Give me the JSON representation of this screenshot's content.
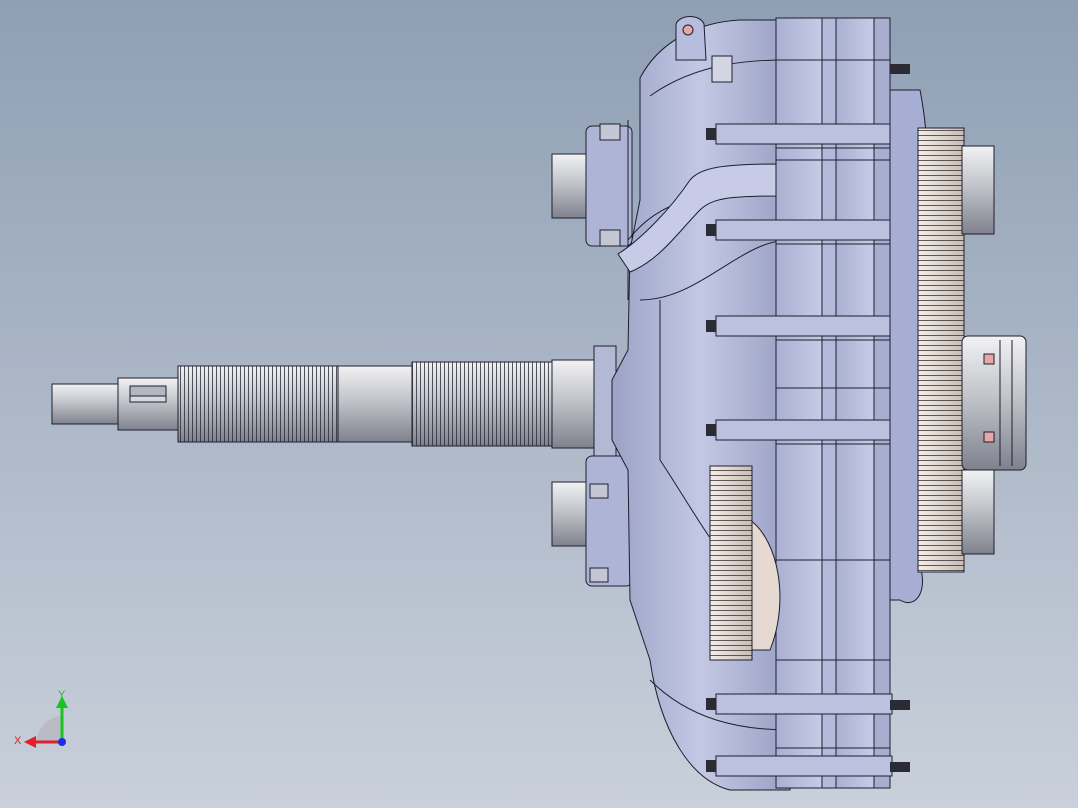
{
  "scene": {
    "background_top": "#8f9fb4",
    "background_bottom": "#c9d0db",
    "part_color": "#b8bedc",
    "part_dark": "#8d94b8",
    "line_color": "#1d1f2e",
    "shaft_color": "#c4c6cc",
    "gear_color": "#e6ddd6",
    "hole_color": "#e8a7a7"
  },
  "triad": {
    "x_label": "X",
    "y_label": "Y",
    "x_color": "#e0202a",
    "y_color": "#18c41f",
    "z_color": "#1c2ce8"
  }
}
